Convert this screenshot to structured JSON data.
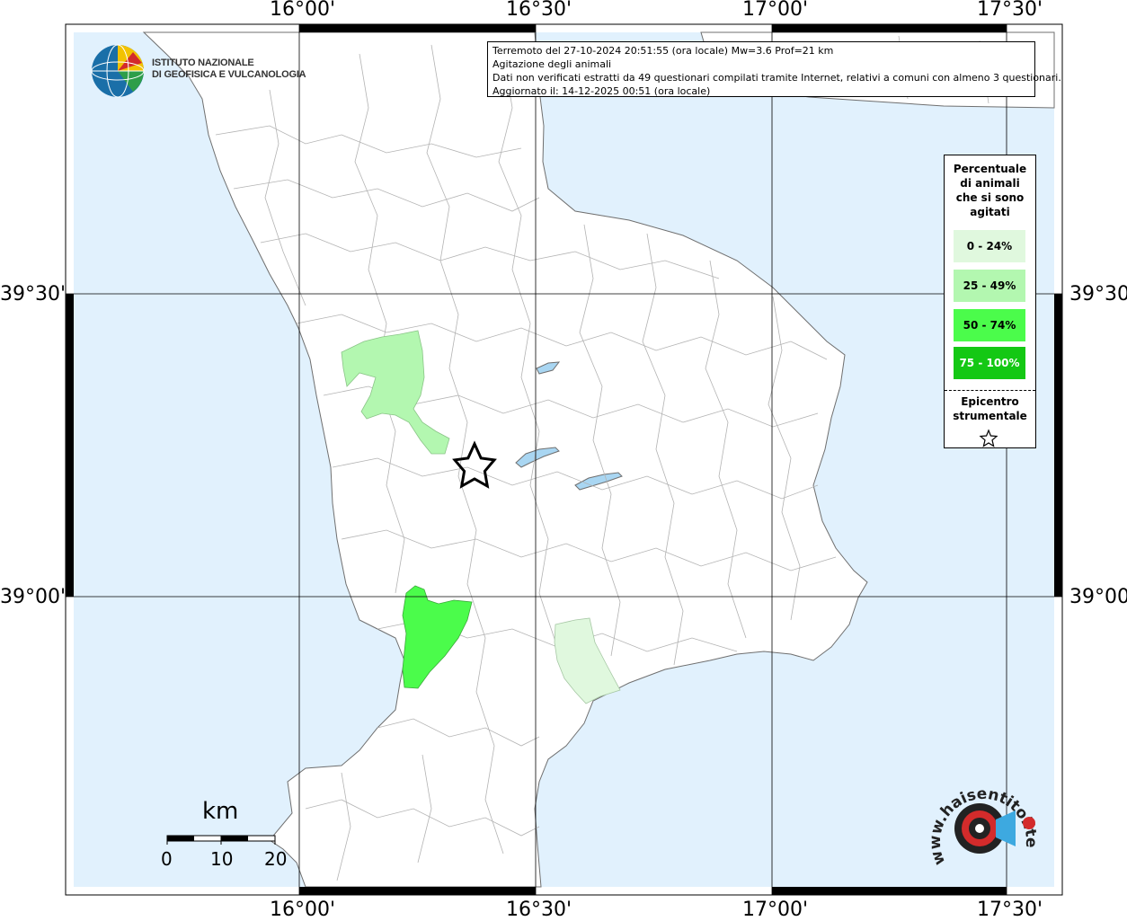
{
  "map": {
    "longitude_labels": [
      "16°00'",
      "16°30'",
      "17°00'",
      "17°30'"
    ],
    "latitude_labels": [
      "39°30'",
      "39°00'"
    ],
    "colors": {
      "sea": "#e1f1fd",
      "land": "#ffffff",
      "borders": "#b3b3b3",
      "lakes": "#a9d6f2"
    }
  },
  "info": {
    "line1": "Terremoto del 27-10-2024 20:51:55 (ora locale) Mw=3.6 Prof=21 km",
    "line2": "Agitazione degli animali",
    "line3": "Dati non verificati estratti da 49 questionari compilati tramite Internet, relativi a comuni con almeno 3 questionari.",
    "line4": "Aggiornato il: 14-12-2025 00:51 (ora locale)"
  },
  "legend": {
    "title_lines": [
      "Percentuale",
      "di animali",
      "che si sono",
      "agitati"
    ],
    "classes": [
      {
        "label": "0 - 24%",
        "color": "#e0f8de",
        "text_color": "#000000"
      },
      {
        "label": "25 - 49%",
        "color": "#b3f7b0",
        "text_color": "#000000"
      },
      {
        "label": "50 - 74%",
        "color": "#4bfc4b",
        "text_color": "#000000"
      },
      {
        "label": "75 - 100%",
        "color": "#14c814",
        "text_color": "#ffffff"
      }
    ],
    "epicenter_lines": [
      "Epicentro",
      "strumentale"
    ]
  },
  "logos": {
    "ingv_line1": "ISTITUTO NAZIONALE",
    "ingv_line2": "DI GEOFISICA E VULCANOLOGIA",
    "hst_text": "www.haisentitoilterremoto.it"
  },
  "scale": {
    "unit": "km",
    "ticks": [
      "0",
      "10",
      "20"
    ]
  }
}
